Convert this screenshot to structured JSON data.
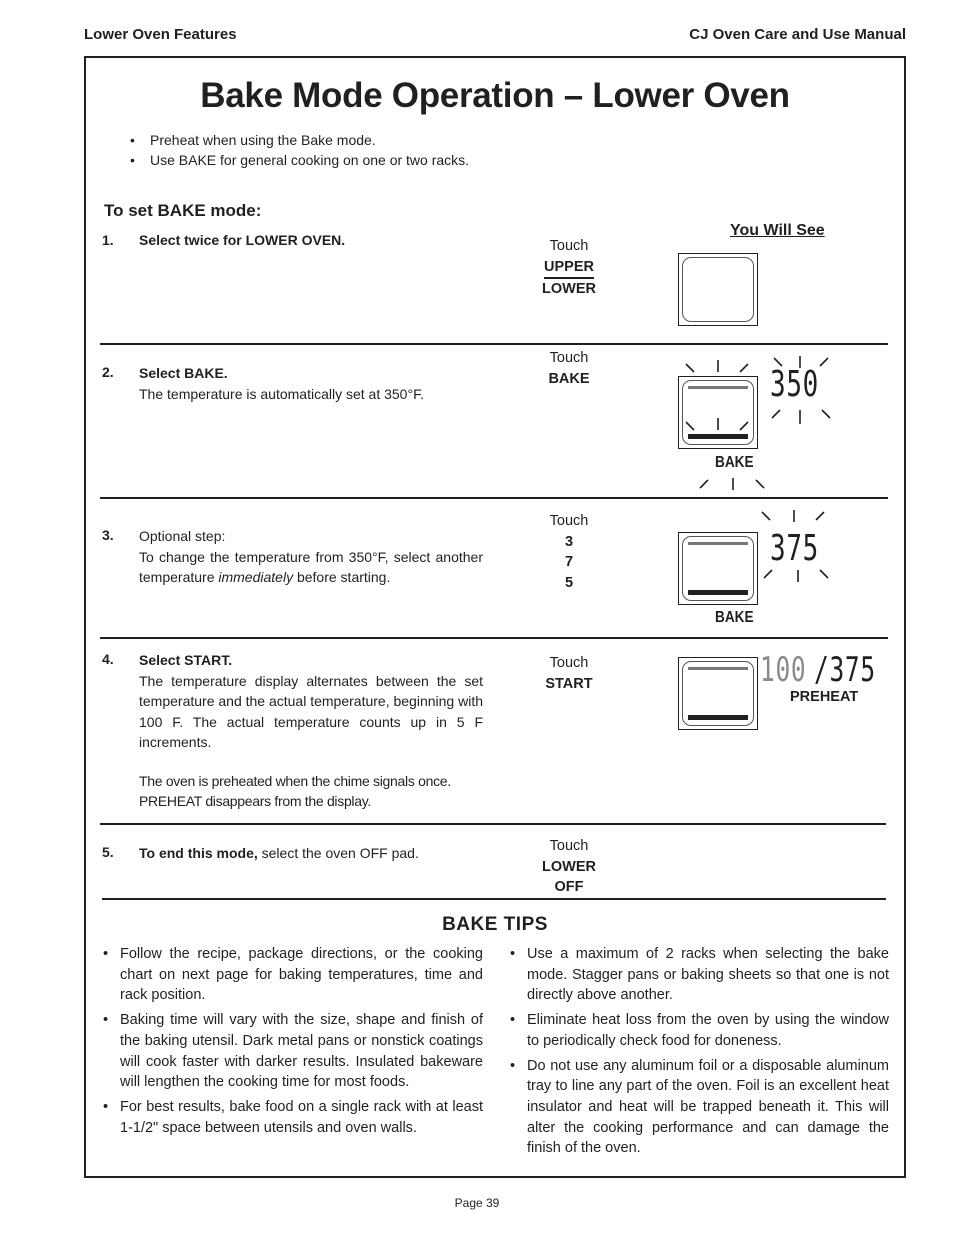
{
  "header": {
    "left": "Lower Oven Features",
    "right": "CJ Oven Care and Use Manual"
  },
  "title": "Bake Mode Operation – Lower Oven",
  "intro_bullets": [
    "Preheat when using the Bake mode.",
    "Use BAKE for general cooking on one or two racks."
  ],
  "subheading": "To set BAKE mode:",
  "you_will_see_label": "You Will See",
  "touch_label": "Touch",
  "steps": [
    {
      "number": "1.",
      "title": "Select twice for LOWER OVEN.",
      "keys": [
        "UPPER",
        "LOWER"
      ]
    },
    {
      "number": "2.",
      "title": "Select BAKE.",
      "body": "The temperature is automatically set at 350°F.",
      "keys": [
        "BAKE"
      ],
      "display": {
        "temp": "350",
        "mode": "BAKE"
      }
    },
    {
      "number": "3.",
      "title": "Optional step:",
      "body_before": "To change the temperature from 350°F, select another temperature ",
      "body_italic": "immediately",
      "body_after": " before  starting.",
      "keys": [
        "3",
        "7",
        "5"
      ],
      "display": {
        "temp": "375",
        "mode": "BAKE"
      }
    },
    {
      "number": "4.",
      "title": "Select  START.",
      "body": "The temperature display alternates between the set temperature and the actual temperature, beginning with 100 F.  The actual temperature counts up in 5  F increments.",
      "body2": "The oven is preheated when the chime signals once. PREHEAT disappears from the display.",
      "keys": [
        "START"
      ],
      "display": {
        "actual_temp": "100",
        "set_temp": "/375",
        "status": "PREHEAT"
      }
    },
    {
      "number": "5.",
      "title": "To end this mode,",
      "body": " select the oven OFF pad.",
      "keys": [
        "LOWER",
        "OFF"
      ]
    }
  ],
  "tips": {
    "title": "BAKE TIPS",
    "left": [
      "Follow the recipe, package directions, or the cooking chart on next page for baking temperatures,  time and rack position.",
      "Baking time will vary with the size, shape and finish of the baking utensil. Dark metal pans or nonstick coatings will cook faster with darker results. Insulated bakeware will lengthen the cooking time for most foods.",
      "For best results, bake food on a single rack with at least 1-1/2\" space between utensils and oven walls."
    ],
    "right": [
      "Use a maximum of 2 racks when selecting the bake mode.  Stagger pans or baking sheets so that one is not directly above another.",
      "Eliminate heat loss from the oven by using the window to periodically check food for doneness.",
      "Do not use any aluminum foil or a disposable aluminum tray to line any part of the oven.  Foil is an excellent heat insulator and heat will be trapped beneath it. This will alter the cooking performance and can damage the finish of the oven."
    ]
  },
  "footer": "Page 39"
}
